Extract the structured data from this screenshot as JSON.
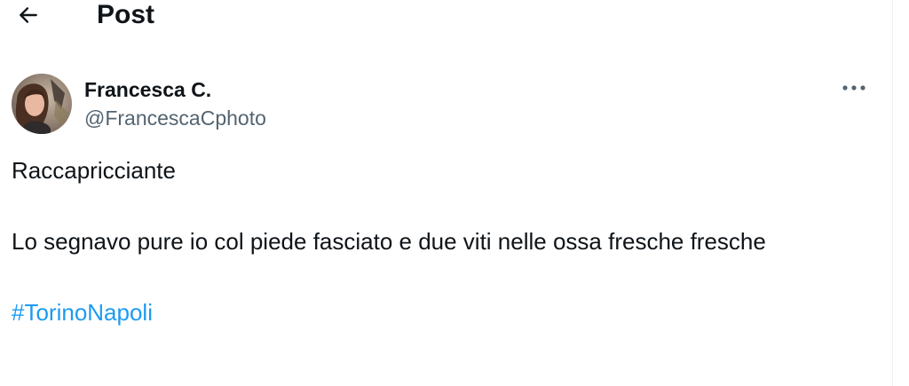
{
  "header": {
    "back_icon": "arrow-left-icon",
    "title": "Post"
  },
  "post": {
    "author": {
      "display_name": "Francesca C.",
      "handle": "@FrancescaCphoto",
      "avatar": "avatar-photo"
    },
    "more_icon": "more-horizontal-icon",
    "text": {
      "line1": "Raccapricciante",
      "line2": "Lo segnavo pure io col piede fasciato e due viti nelle ossa fresche fresche",
      "hashtag": "#TorinoNapoli"
    }
  },
  "colors": {
    "text_primary": "#0f1419",
    "text_secondary": "#536471",
    "link": "#1d9bf0",
    "divider": "#eff3f4"
  }
}
